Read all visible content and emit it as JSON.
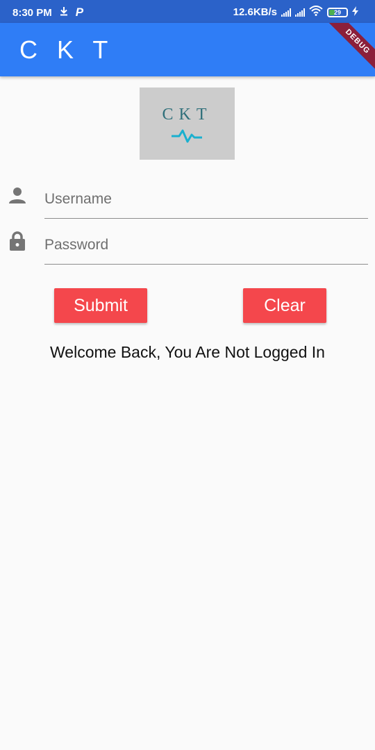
{
  "status_bar": {
    "time": "8:30 PM",
    "p_badge": "P",
    "speed": "12.6KB/s",
    "battery_level": "29",
    "battery_fraction": 0.29
  },
  "app_bar": {
    "title": "C K T",
    "debug_banner": "DEBUG",
    "color": "#2f7df6"
  },
  "logo": {
    "text": "CKT",
    "wave_color": "#1ab0cf"
  },
  "form": {
    "username": {
      "placeholder": "Username",
      "value": "",
      "icon": "person-icon"
    },
    "password": {
      "placeholder": "Password",
      "value": "",
      "icon": "lock-icon"
    }
  },
  "buttons": {
    "submit_label": "Submit",
    "clear_label": "Clear",
    "color": "#f4474c"
  },
  "message": "Welcome Back, You Are Not Logged In"
}
